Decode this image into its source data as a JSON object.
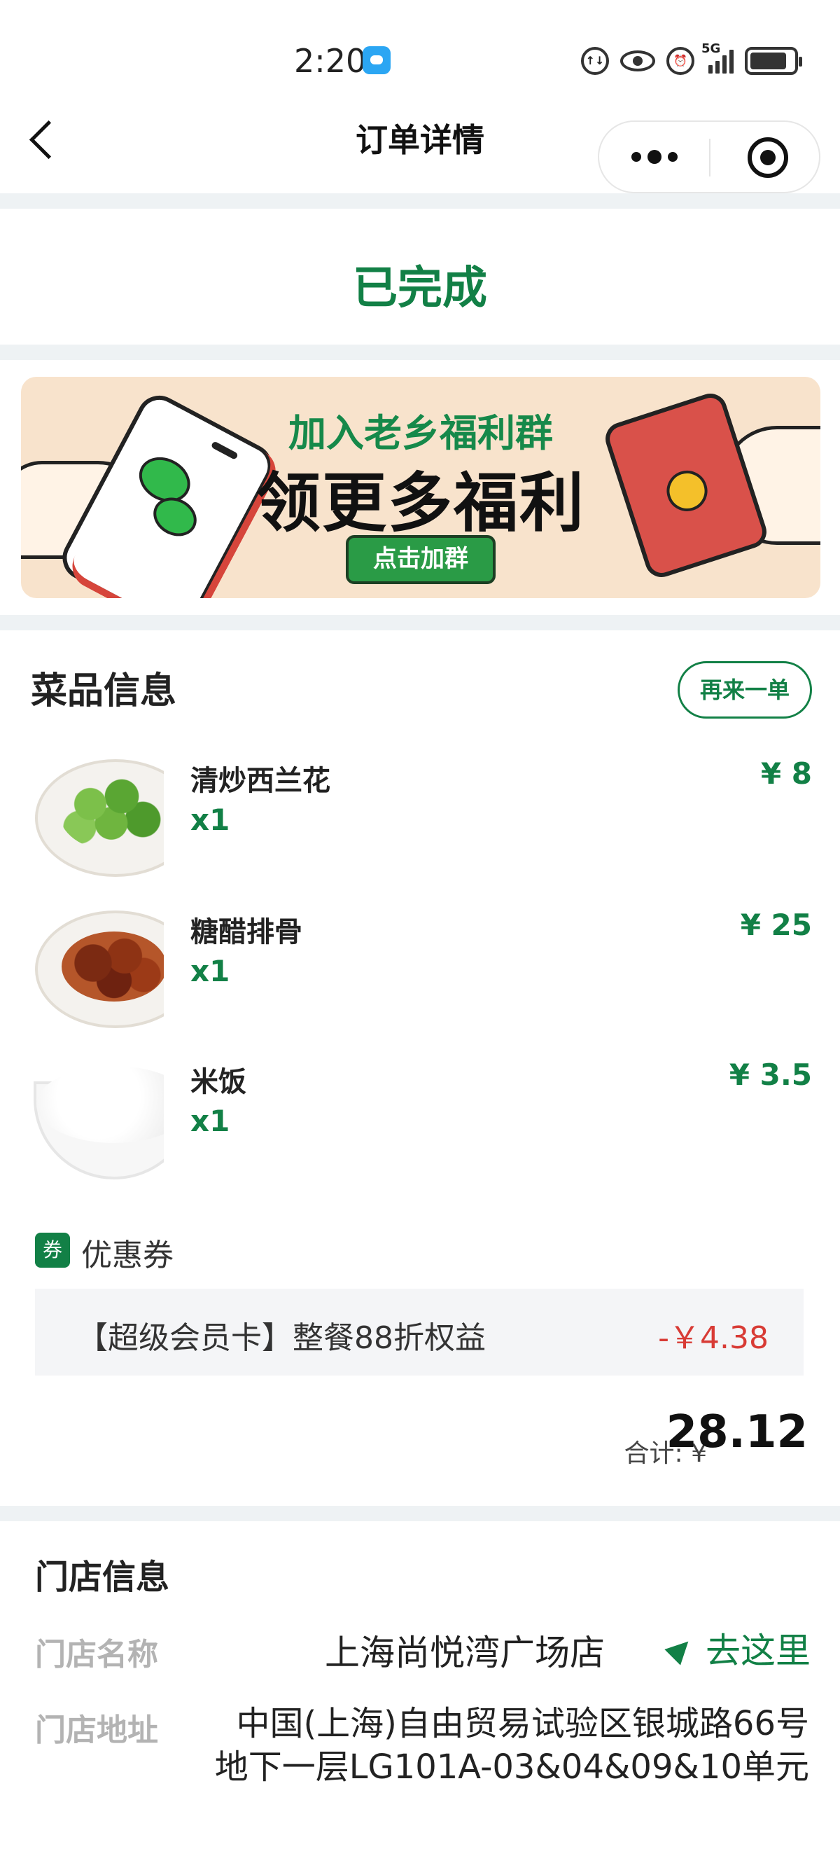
{
  "status_bar": {
    "time": "2:20",
    "network": "5G"
  },
  "nav": {
    "title": "订单详情"
  },
  "order": {
    "status": "已完成"
  },
  "banner": {
    "line1": "加入老乡福利群",
    "line2": "领更多福利",
    "button": "点击加群"
  },
  "dishes_section": {
    "title": "菜品信息",
    "reorder_label": "再来一单",
    "items": [
      {
        "name": "清炒西兰花",
        "qty": "x1",
        "price": "¥ 8"
      },
      {
        "name": "糖醋排骨",
        "qty": "x1",
        "price": "¥ 25"
      },
      {
        "name": "米饭",
        "qty": "x1",
        "price": "¥ 3.5"
      }
    ]
  },
  "coupon": {
    "badge": "券",
    "label": "优惠券",
    "name": "【超级会员卡】整餐88折权益",
    "amount": "-￥4.38"
  },
  "total": {
    "label": "合计: ¥",
    "value": "28.12"
  },
  "store": {
    "title": "门店信息",
    "name_label": "门店名称",
    "name": "上海尚悦湾广场店",
    "go_label": "去这里",
    "address_label": "门店地址",
    "address": "中国(上海)自由贸易试验区银城路66号地下一层LG101A-03&04&09&10单元"
  },
  "colors": {
    "accent": "#128046",
    "discount": "#d83b35",
    "separator": "#eef2f4"
  }
}
